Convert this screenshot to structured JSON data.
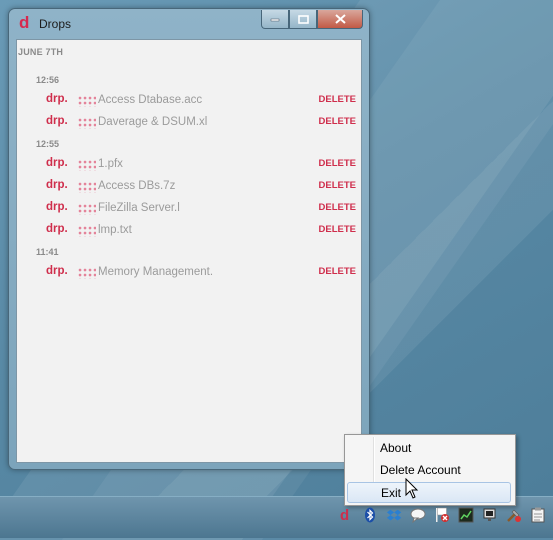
{
  "window": {
    "title": "Drops",
    "logo_letter": "d",
    "min_glyph": "–",
    "max_glyph": "□",
    "close_glyph": "✕"
  },
  "drops": {
    "date_header": "JUNE 7TH",
    "delete_label": "DELETE",
    "groups": [
      {
        "time": "12:56",
        "items": [
          {
            "prefix": "drp.",
            "name": "Access Dtabase.acc"
          },
          {
            "prefix": "drp.",
            "name": "Daverage & DSUM.xl"
          }
        ]
      },
      {
        "time": "12:55",
        "items": [
          {
            "prefix": "drp.",
            "name": "1.pfx"
          },
          {
            "prefix": "drp.",
            "name": "Access DBs.7z"
          },
          {
            "prefix": "drp.",
            "name": "FileZilla Server.l"
          },
          {
            "prefix": "drp.",
            "name": "lmp.txt"
          }
        ]
      },
      {
        "time": "11:41",
        "items": [
          {
            "prefix": "drp.",
            "name": "Memory Management."
          }
        ]
      }
    ]
  },
  "context_menu": {
    "items": [
      "About",
      "Delete Account",
      "Exit"
    ],
    "highlighted": "Exit"
  },
  "tray": {
    "icons": [
      "drops-icon",
      "bluetooth-icon",
      "dropbox-icon",
      "chat-icon",
      "flag-icon",
      "network-icon",
      "monitor-icon",
      "tools-icon",
      "clipboard-icon"
    ],
    "brand_color": "#cf2e4c"
  }
}
